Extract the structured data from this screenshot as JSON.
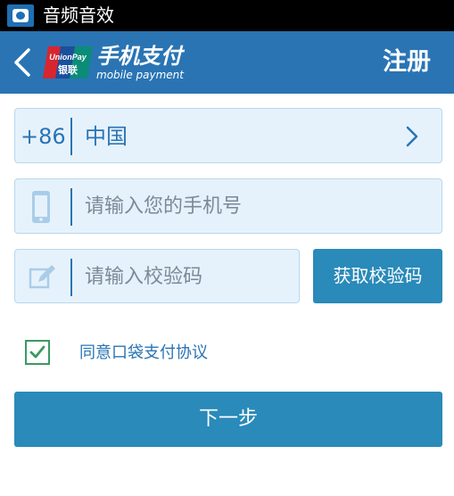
{
  "status_bar": {
    "app_title": "音频音效"
  },
  "header": {
    "logo_brand": "UnionPay",
    "logo_cn": "银联",
    "logo_main": "手机支付",
    "logo_sub": "mobile payment",
    "title": "注册"
  },
  "form": {
    "country_code": "+86",
    "country_name": "中国",
    "phone_placeholder": "请输入您的手机号",
    "code_placeholder": "请输入校验码",
    "get_code_label": "获取校验码",
    "agreement_label": "同意口袋支付协议",
    "agreement_checked": true,
    "next_label": "下一步"
  },
  "colors": {
    "header_bg": "#2a74b4",
    "button_bg": "#2a8ab9",
    "field_bg": "#e6f2fb",
    "check_green": "#3a9a62"
  },
  "icons": [
    "back-arrow-icon",
    "unionpay-logo-icon",
    "chevron-right-icon",
    "phone-icon",
    "edit-icon",
    "checkmark-icon"
  ]
}
